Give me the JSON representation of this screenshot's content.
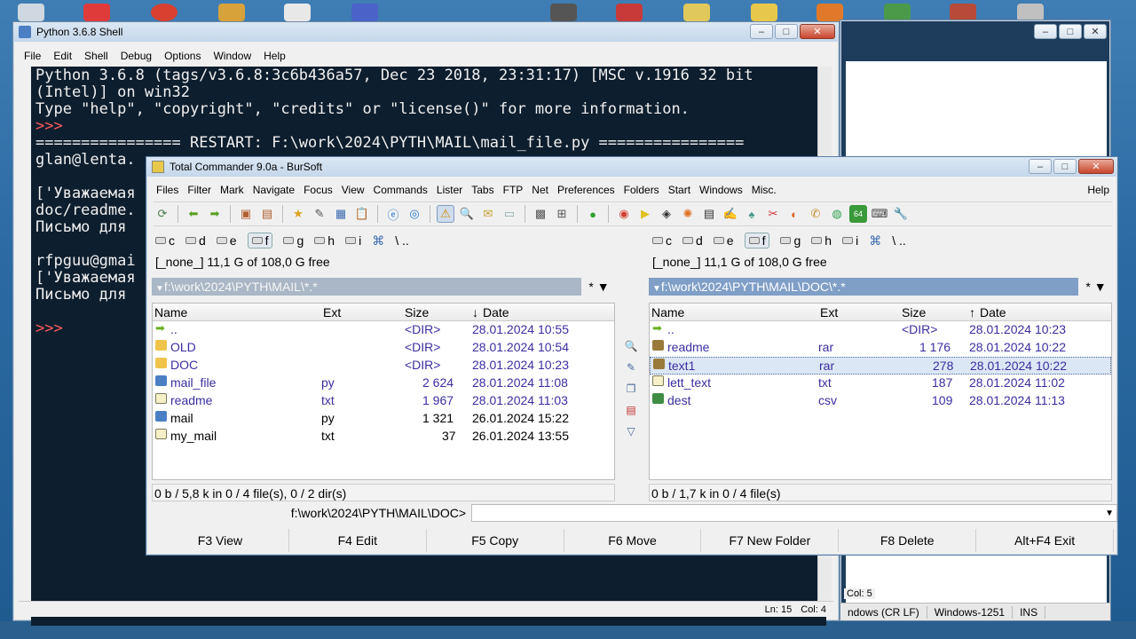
{
  "python_shell": {
    "title": "Python 3.6.8 Shell",
    "menu": [
      "File",
      "Edit",
      "Shell",
      "Debug",
      "Options",
      "Window",
      "Help"
    ],
    "lines": [
      "Python 3.6.8 (tags/v3.6.8:3c6b436a57, Dec 23 2018, 23:31:17) [MSC v.1916 32 bit",
      "(Intel)] on win32",
      "Type \"help\", \"copyright\", \"credits\" or \"license()\" for more information.",
      ">>>",
      "================ RESTART: F:\\work\\2024\\PYTH\\MAIL\\mail_file.py ================",
      "glan@lenta.",
      "",
      "['Уважаемая",
      "doc/readme.",
      "Письмо для",
      "",
      "rfpguu@gmai",
      "['Уважаемая",
      "Письмо для",
      "",
      ">>>"
    ],
    "status": {
      "ln": "Ln: 15",
      "col": "Col: 4"
    }
  },
  "bg_window": {
    "status": [
      "ndows (CR LF)",
      "Windows-1251",
      "INS"
    ],
    "col": "Col: 5"
  },
  "total_commander": {
    "title": "Total Commander 9.0a - BurSoft",
    "menu": [
      "Files",
      "Filter",
      "Mark",
      "Navigate",
      "Focus",
      "View",
      "Commands",
      "Lister",
      "Tabs",
      "FTP",
      "Net",
      "Preferences",
      "Folders",
      "Start",
      "Windows",
      "Misc."
    ],
    "help": "Help",
    "left": {
      "drives": [
        "c",
        "d",
        "e",
        "f",
        "g",
        "h",
        "i"
      ],
      "nav": "\\  ..",
      "free": "[_none_]  11,1 G of 108,0 G free",
      "path": "f:\\work\\2024\\PYTH\\MAIL\\*.*",
      "filter": "* ▼",
      "headers": {
        "name": "Name",
        "ext": "Ext",
        "size": "Size",
        "date": "Date"
      },
      "sort_arrow": "↓",
      "files": [
        {
          "icon": "up",
          "name": "..",
          "ext": "",
          "size": "<DIR>",
          "date": "28.01.2024 10:55"
        },
        {
          "icon": "folder",
          "name": "OLD",
          "ext": "",
          "size": "<DIR>",
          "date": "28.01.2024 10:54"
        },
        {
          "icon": "folder",
          "name": "DOC",
          "ext": "",
          "size": "<DIR>",
          "date": "28.01.2024 10:23"
        },
        {
          "icon": "py",
          "name": "mail_file",
          "ext": "py",
          "size": "2 624",
          "date": "28.01.2024 11:08"
        },
        {
          "icon": "txt",
          "name": "readme",
          "ext": "txt",
          "size": "1 967",
          "date": "28.01.2024 11:03"
        },
        {
          "icon": "py",
          "name": "mail",
          "ext": "py",
          "size": "1 321",
          "date": "26.01.2024 15:22"
        },
        {
          "icon": "txt",
          "name": "my_mail",
          "ext": "txt",
          "size": "37",
          "date": "26.01.2024 13:55"
        }
      ],
      "status": "0 b / 5,8 k in 0 / 4 file(s), 0 / 2 dir(s)"
    },
    "right": {
      "drives": [
        "c",
        "d",
        "e",
        "f",
        "g",
        "h",
        "i"
      ],
      "nav": "\\  ..",
      "free": "[_none_]  11,1 G of 108,0 G free",
      "path": "f:\\work\\2024\\PYTH\\MAIL\\DOC\\*.*",
      "filter": "* ▼",
      "headers": {
        "name": "Name",
        "ext": "Ext",
        "size": "Size",
        "date": "Date"
      },
      "sort_arrow": "↑",
      "files": [
        {
          "icon": "up",
          "name": "..",
          "ext": "",
          "size": "<DIR>",
          "date": "28.01.2024 10:23"
        },
        {
          "icon": "rar",
          "name": "readme",
          "ext": "rar",
          "size": "1 176",
          "date": "28.01.2024 10:22"
        },
        {
          "icon": "rar",
          "name": "text1",
          "ext": "rar",
          "size": "278",
          "date": "28.01.2024 10:22",
          "selected": true
        },
        {
          "icon": "txt",
          "name": "lett_text",
          "ext": "txt",
          "size": "187",
          "date": "28.01.2024 11:02"
        },
        {
          "icon": "csv",
          "name": "dest",
          "ext": "csv",
          "size": "109",
          "date": "28.01.2024 11:13"
        }
      ],
      "status": "0 b / 1,7 k in 0 / 4 file(s)"
    },
    "cmd_path": "f:\\work\\2024\\PYTH\\MAIL\\DOC>",
    "fkeys": [
      "F3 View",
      "F4 Edit",
      "F5 Copy",
      "F6 Move",
      "F7 New Folder",
      "F8 Delete",
      "Alt+F4 Exit"
    ]
  }
}
